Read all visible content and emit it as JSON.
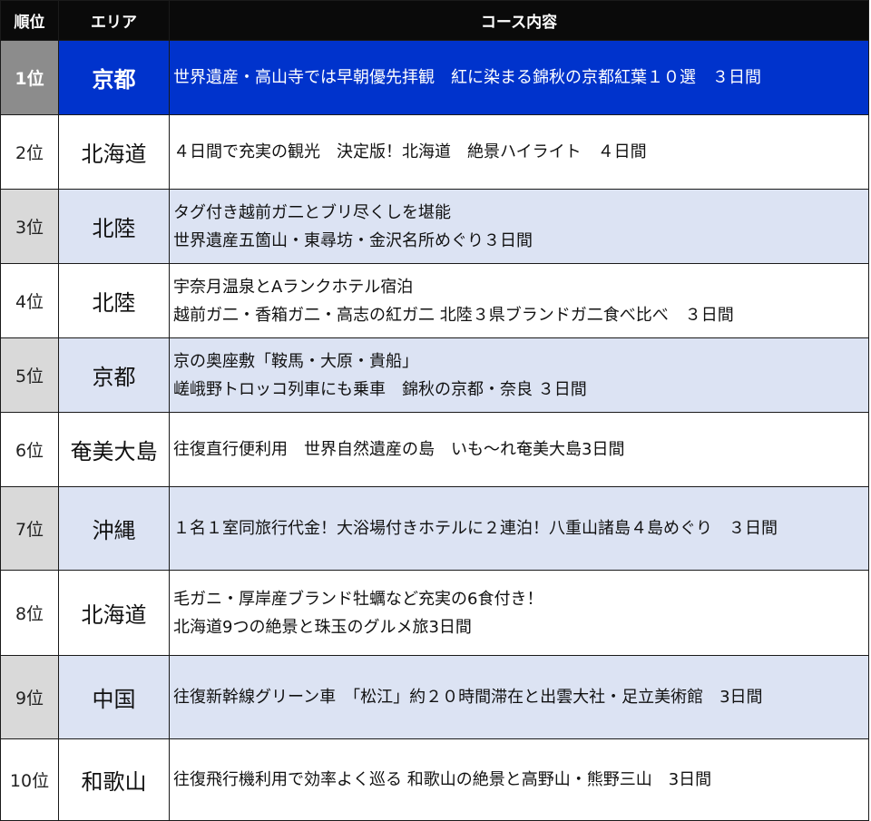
{
  "header": {
    "rank": "順位",
    "area": "エリア",
    "course": "コース内容"
  },
  "rows": [
    {
      "rank": "1位",
      "area": "京都",
      "lines": [
        "世界遺産・高山寺では早朝優先拝観　紅に染まる錦秋の京都紅葉１０選　３日間"
      ]
    },
    {
      "rank": "2位",
      "area": "北海道",
      "lines": [
        "４日間で充実の観光　決定版！北海道　絶景ハイライト　４日間"
      ]
    },
    {
      "rank": "3位",
      "area": "北陸",
      "lines": [
        "タグ付き越前ガ二とブリ尽くしを堪能",
        "世界遺産五箇山・東尋坊・金沢名所めぐり３日間"
      ]
    },
    {
      "rank": "4位",
      "area": "北陸",
      "lines": [
        "宇奈月温泉とAランクホテル宿泊",
        "越前ガ二・香箱ガ二・高志の紅ガ二 北陸３県ブランドガ二食べ比べ　３日間"
      ]
    },
    {
      "rank": "5位",
      "area": "京都",
      "lines": [
        "京の奥座敷「鞍馬・大原・貴船」",
        "嵯峨野トロッコ列車にも乗車　錦秋の京都・奈良 ３日間"
      ]
    },
    {
      "rank": "6位",
      "area": "奄美大島",
      "lines": [
        "往復直行便利用　世界自然遺産の島　いも～れ奄美大島3日間"
      ]
    },
    {
      "rank": "7位",
      "area": "沖縄",
      "lines": [
        "１名１室同旅行代金！大浴場付きホテルに２連泊！八重山諸島４島めぐり　３日間"
      ]
    },
    {
      "rank": "8位",
      "area": "北海道",
      "lines": [
        "毛ガニ・厚岸産ブランド牡蠣など充実の6食付き！",
        "北海道9つの絶景と珠玉のグルメ旅3日間"
      ]
    },
    {
      "rank": "9位",
      "area": "中国",
      "lines": [
        "往復新幹線グリーン車　「松江」約２０時間滞在と出雲大社・足立美術館　3日間"
      ]
    },
    {
      "rank": "10位",
      "area": "和歌山",
      "lines": [
        "往復飛行機利用で効率よく巡る 和歌山の絶景と高野山・熊野三山　3日間"
      ]
    }
  ]
}
